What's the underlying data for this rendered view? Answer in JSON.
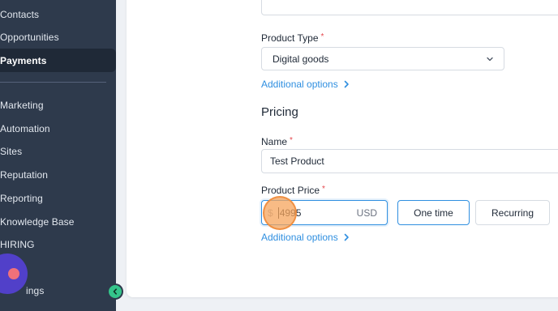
{
  "sidebar": {
    "items": [
      {
        "label": "Contacts"
      },
      {
        "label": "Opportunities"
      },
      {
        "label": "Payments"
      },
      {
        "label": "Marketing"
      },
      {
        "label": "Automation"
      },
      {
        "label": "Sites"
      },
      {
        "label": "Reputation"
      },
      {
        "label": "Reporting"
      },
      {
        "label": "Knowledge Base"
      },
      {
        "label": "HIRING"
      },
      {
        "label": "ings"
      }
    ],
    "active_label": "Payments",
    "icons": {
      "collapse": "chevron-left-icon",
      "chat": "chat-widget-icon"
    }
  },
  "form": {
    "product_type": {
      "label": "Product Type",
      "required_mark": "*",
      "value": "Digital goods"
    },
    "additional_options_1": "Additional options",
    "pricing_title": "Pricing",
    "name": {
      "label": "Name",
      "required_mark": "*",
      "value": "Test Product"
    },
    "product_price": {
      "label": "Product Price",
      "required_mark": "*",
      "currency_symbol": "$",
      "value": "4995",
      "currency_code": "USD"
    },
    "billing": {
      "one_time": "One time",
      "recurring": "Recurring"
    },
    "additional_options_2": "Additional options"
  },
  "colors": {
    "sidebar_bg": "#2e3a4c",
    "accent_blue": "#2f8fe0",
    "required_red": "#e5484d",
    "collapse_green": "#34c58b",
    "chat_purple": "#5140c9"
  }
}
